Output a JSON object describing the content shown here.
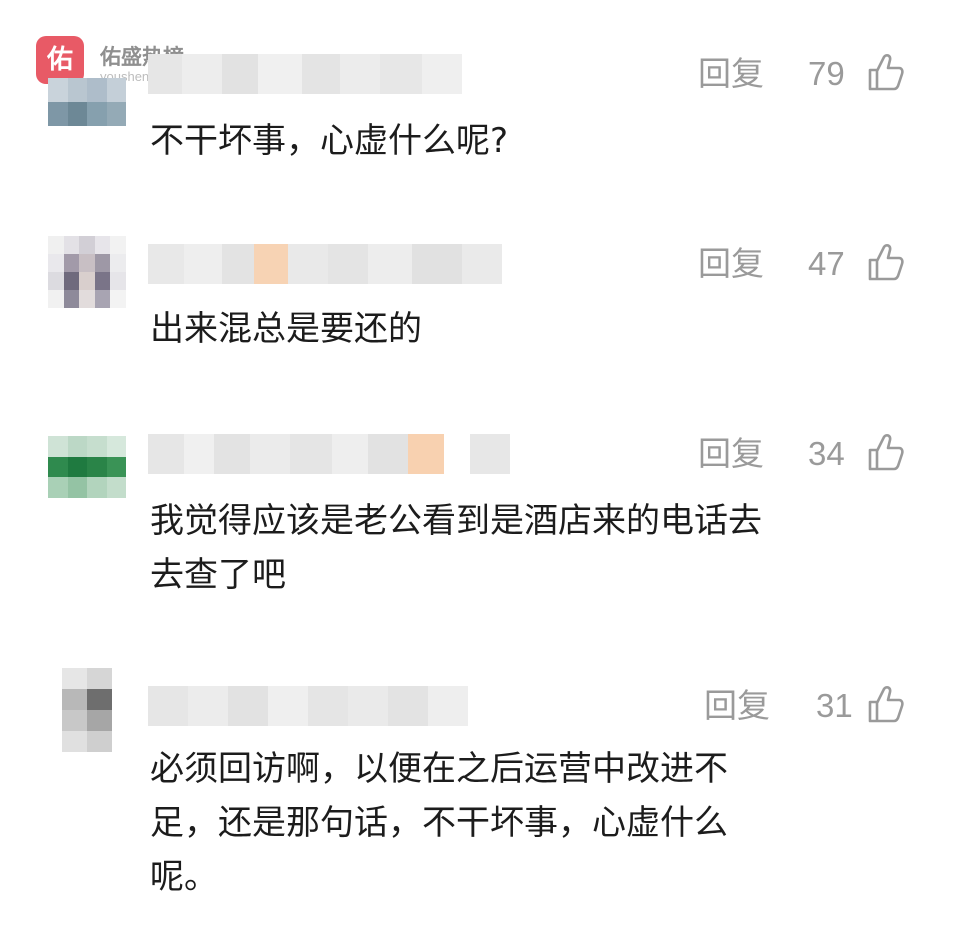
{
  "watermark": {
    "logo_char": "佑",
    "name": "佑盛热榜",
    "url": "youshengprecision.com"
  },
  "colors": {
    "meta_gray": "#9a9a9a",
    "text_dark": "#1c1c1c",
    "logo_red": "#e85a66"
  },
  "icons": {
    "like": "thumbs-up-outline"
  },
  "comments": [
    {
      "reply_label": "回复",
      "likes": "79",
      "lines": [
        "不干坏事，心虚什么呢?"
      ]
    },
    {
      "reply_label": "回复",
      "likes": "47",
      "lines": [
        "出来混总是要还的"
      ]
    },
    {
      "reply_label": "回复",
      "likes": "34",
      "lines": [
        "我觉得应该是老公看到是酒店来的电话去",
        "去查了吧"
      ]
    },
    {
      "reply_label": "回复",
      "likes": "31",
      "lines": [
        "必须回访啊，以便在之后运营中改进不",
        "足，还是那句话，不干坏事，心虚什么",
        "呢。"
      ]
    }
  ]
}
